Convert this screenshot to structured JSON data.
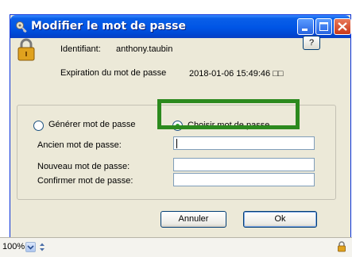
{
  "window": {
    "title": "Modifier le mot de passe",
    "icon": "key-icon",
    "controls": [
      "minimize-icon",
      "maximize-icon",
      "close-icon"
    ]
  },
  "info": {
    "identifiant_label": "Identifiant:",
    "identifiant_value": "anthony.taubin",
    "expiration_label": "Expiration du mot de passe",
    "expiration_value": "2018-01-06 15:49:46 □□",
    "help_label": "?",
    "icon": "padlock-icon"
  },
  "mode": {
    "generate_label": "Générer mot de passe",
    "choose_label": "Choisir mot de passe",
    "selected": "choose"
  },
  "fields": {
    "old_label": "Ancien mot de passe:",
    "old_value": "",
    "new_label": "Nouveau mot de passe:",
    "new_value": "",
    "confirm_label": "Confirmer mot de passe:",
    "confirm_value": ""
  },
  "buttons": {
    "cancel": "Annuler",
    "ok": "Ok"
  },
  "status": {
    "zoom": "100%"
  },
  "colors": {
    "titlebar": "#0055e5",
    "highlight": "#2c8a1e",
    "radio_dot": "#2aa032"
  }
}
